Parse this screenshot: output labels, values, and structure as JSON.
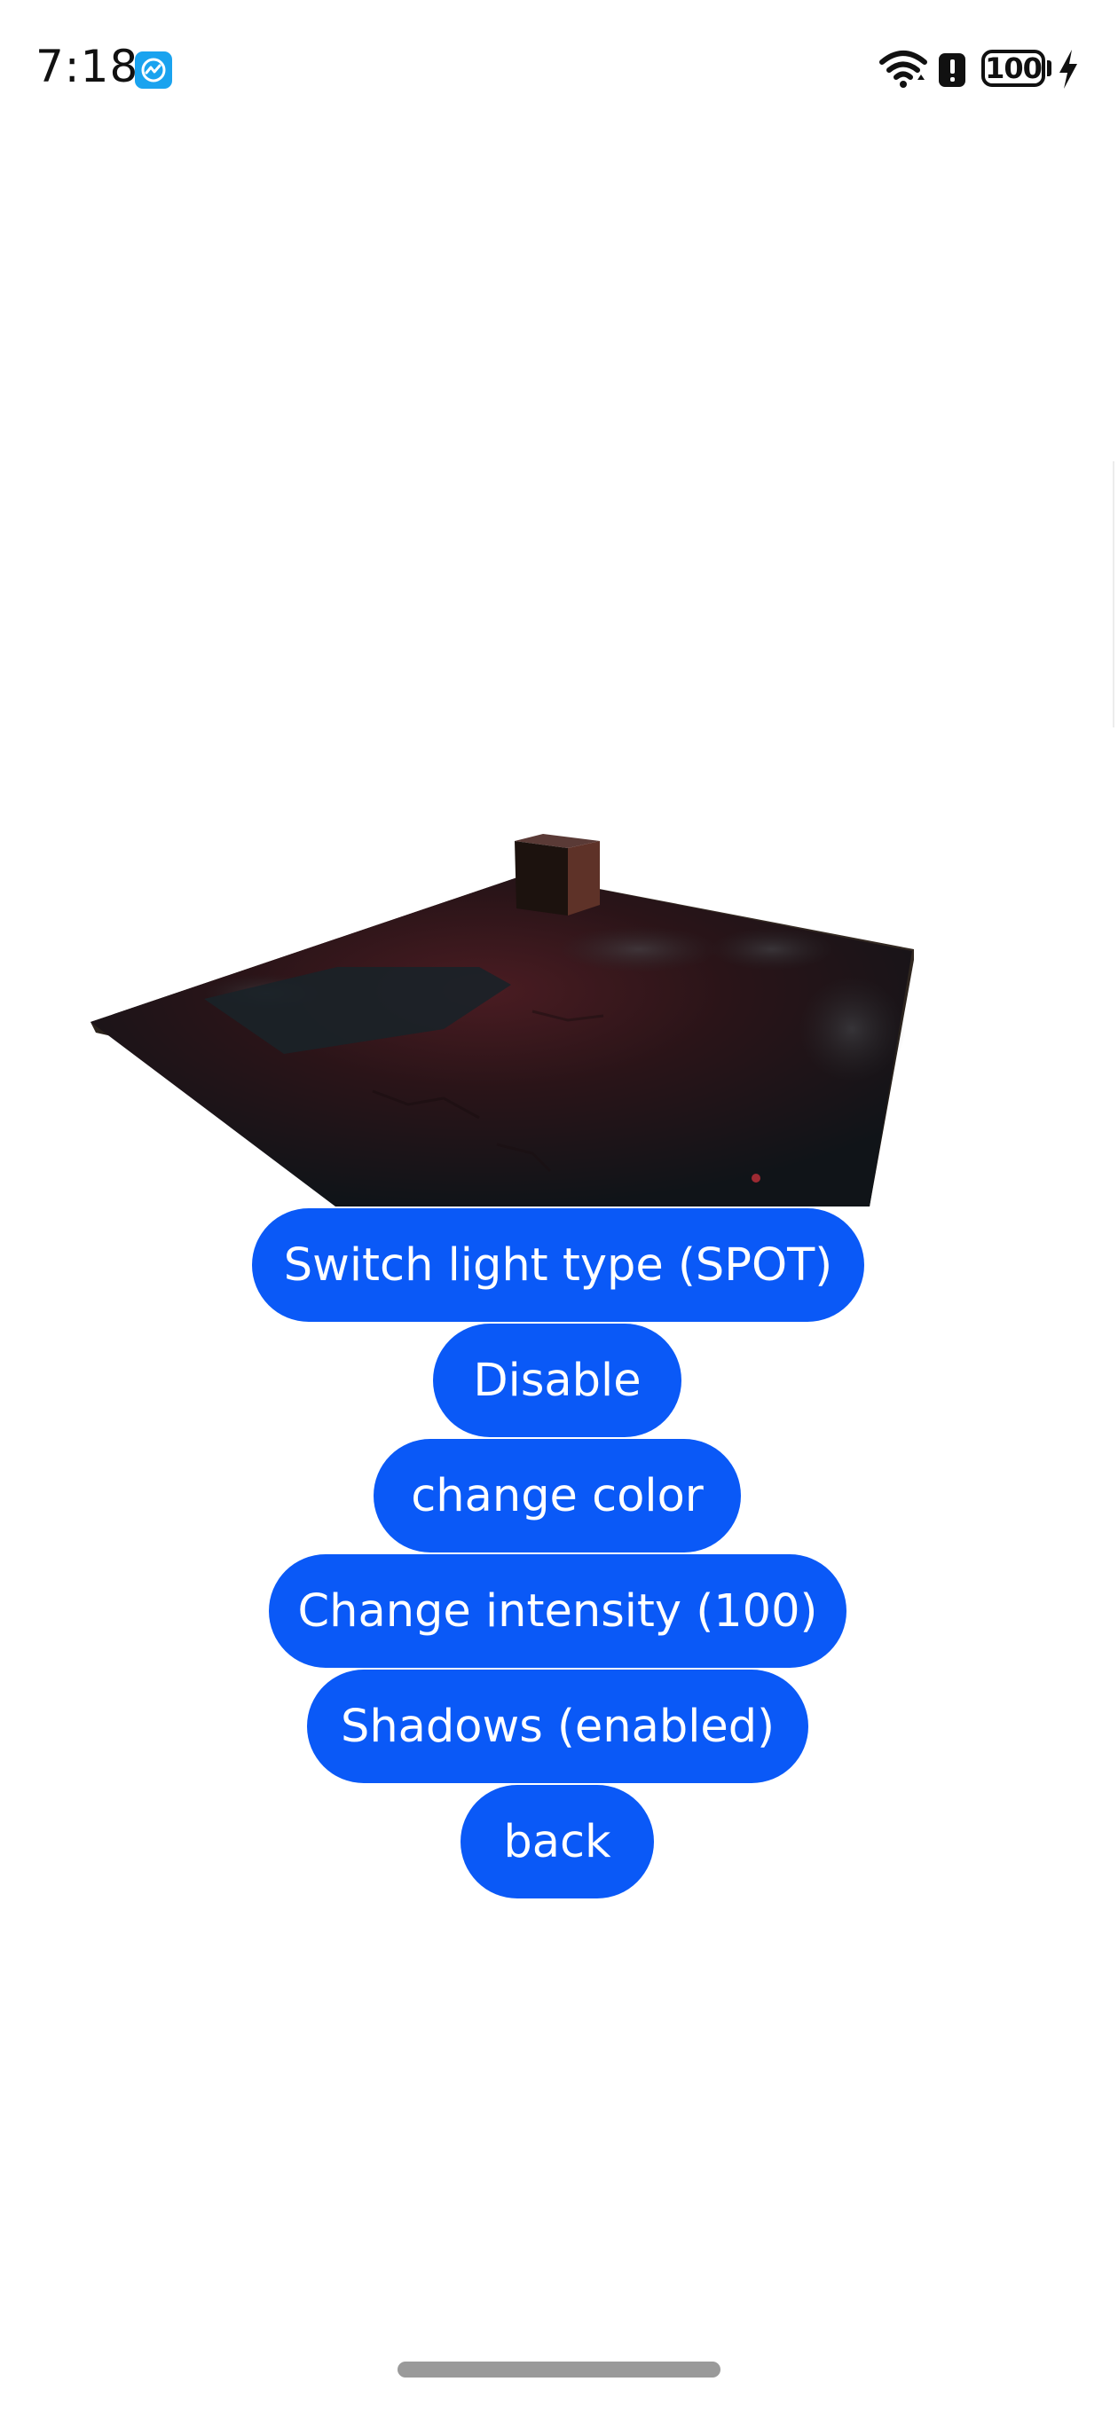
{
  "status_bar": {
    "time": "7:18",
    "battery_level": "100",
    "icons": [
      "app-monitor-icon",
      "wifi-icon",
      "alert-icon",
      "battery-icon",
      "charging-bolt-icon"
    ]
  },
  "scene": {
    "description_icon": "3d-scene-viewport"
  },
  "buttons": {
    "switch_light_type": "Switch light type (SPOT)",
    "disable": "Disable",
    "change_color": "change color",
    "change_intensity": "Change intensity (100)",
    "shadows": "Shadows (enabled)",
    "back": "back"
  },
  "colors": {
    "button_bg": "#0a59f7",
    "button_text": "#ffffff",
    "background": "#ffffff"
  }
}
